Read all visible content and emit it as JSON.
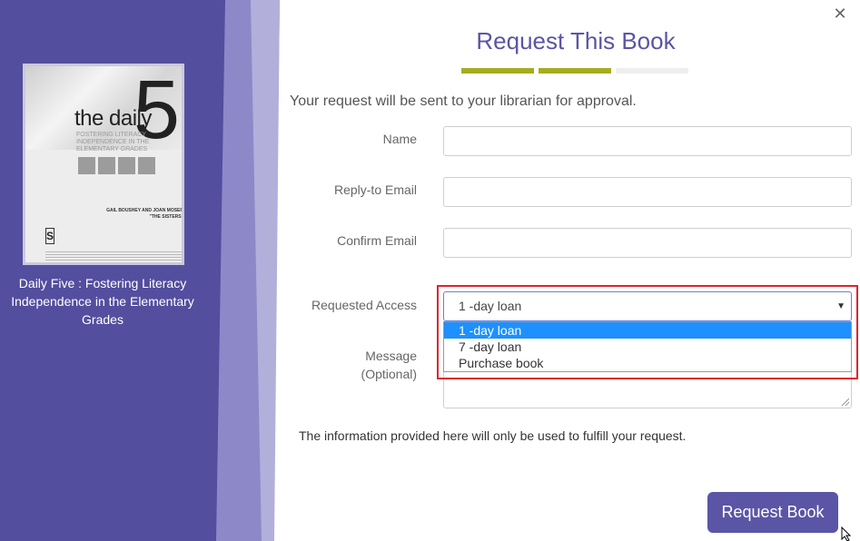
{
  "modal": {
    "title": "Request This Book",
    "intro": "Your request will be sent to your librarian for approval.",
    "notice": "The information provided here will only be used to fulfill your request.",
    "submit_label": "Request Book",
    "close_icon": "close-icon"
  },
  "progress": {
    "steps_total": 3,
    "steps_done": 2,
    "colors": {
      "done": "#a5ad1e",
      "todo": "#eeeeee"
    }
  },
  "book": {
    "caption": "Daily Five : Fostering Literacy Independence in the Elementary Grades",
    "cover_title": "the daily",
    "cover_number": "5",
    "cover_subtitle": "FOSTERING LITERACY INDEPENDENCE IN THE ELEMENTARY GRADES",
    "cover_authors": "GAIL BOUSHEY AND JOAN MOSER \"THE SISTERS\""
  },
  "form": {
    "name_label": "Name",
    "name_value": "",
    "reply_email_label": "Reply-to Email",
    "reply_email_value": "",
    "confirm_email_label": "Confirm Email",
    "confirm_email_value": "",
    "access_label": "Requested Access",
    "access_selected": "1 -day loan",
    "access_options": [
      "1 -day loan",
      "7 -day loan",
      "Purchase book"
    ],
    "message_label_line1": "Message",
    "message_label_line2": "(Optional)",
    "message_value": ""
  },
  "colors": {
    "brand_purple": "#5b55a6",
    "panel_purple": "#534e9e",
    "accent_olive": "#a5ad1e",
    "highlight_red": "#e0242e",
    "option_selected": "#1e90ff"
  }
}
